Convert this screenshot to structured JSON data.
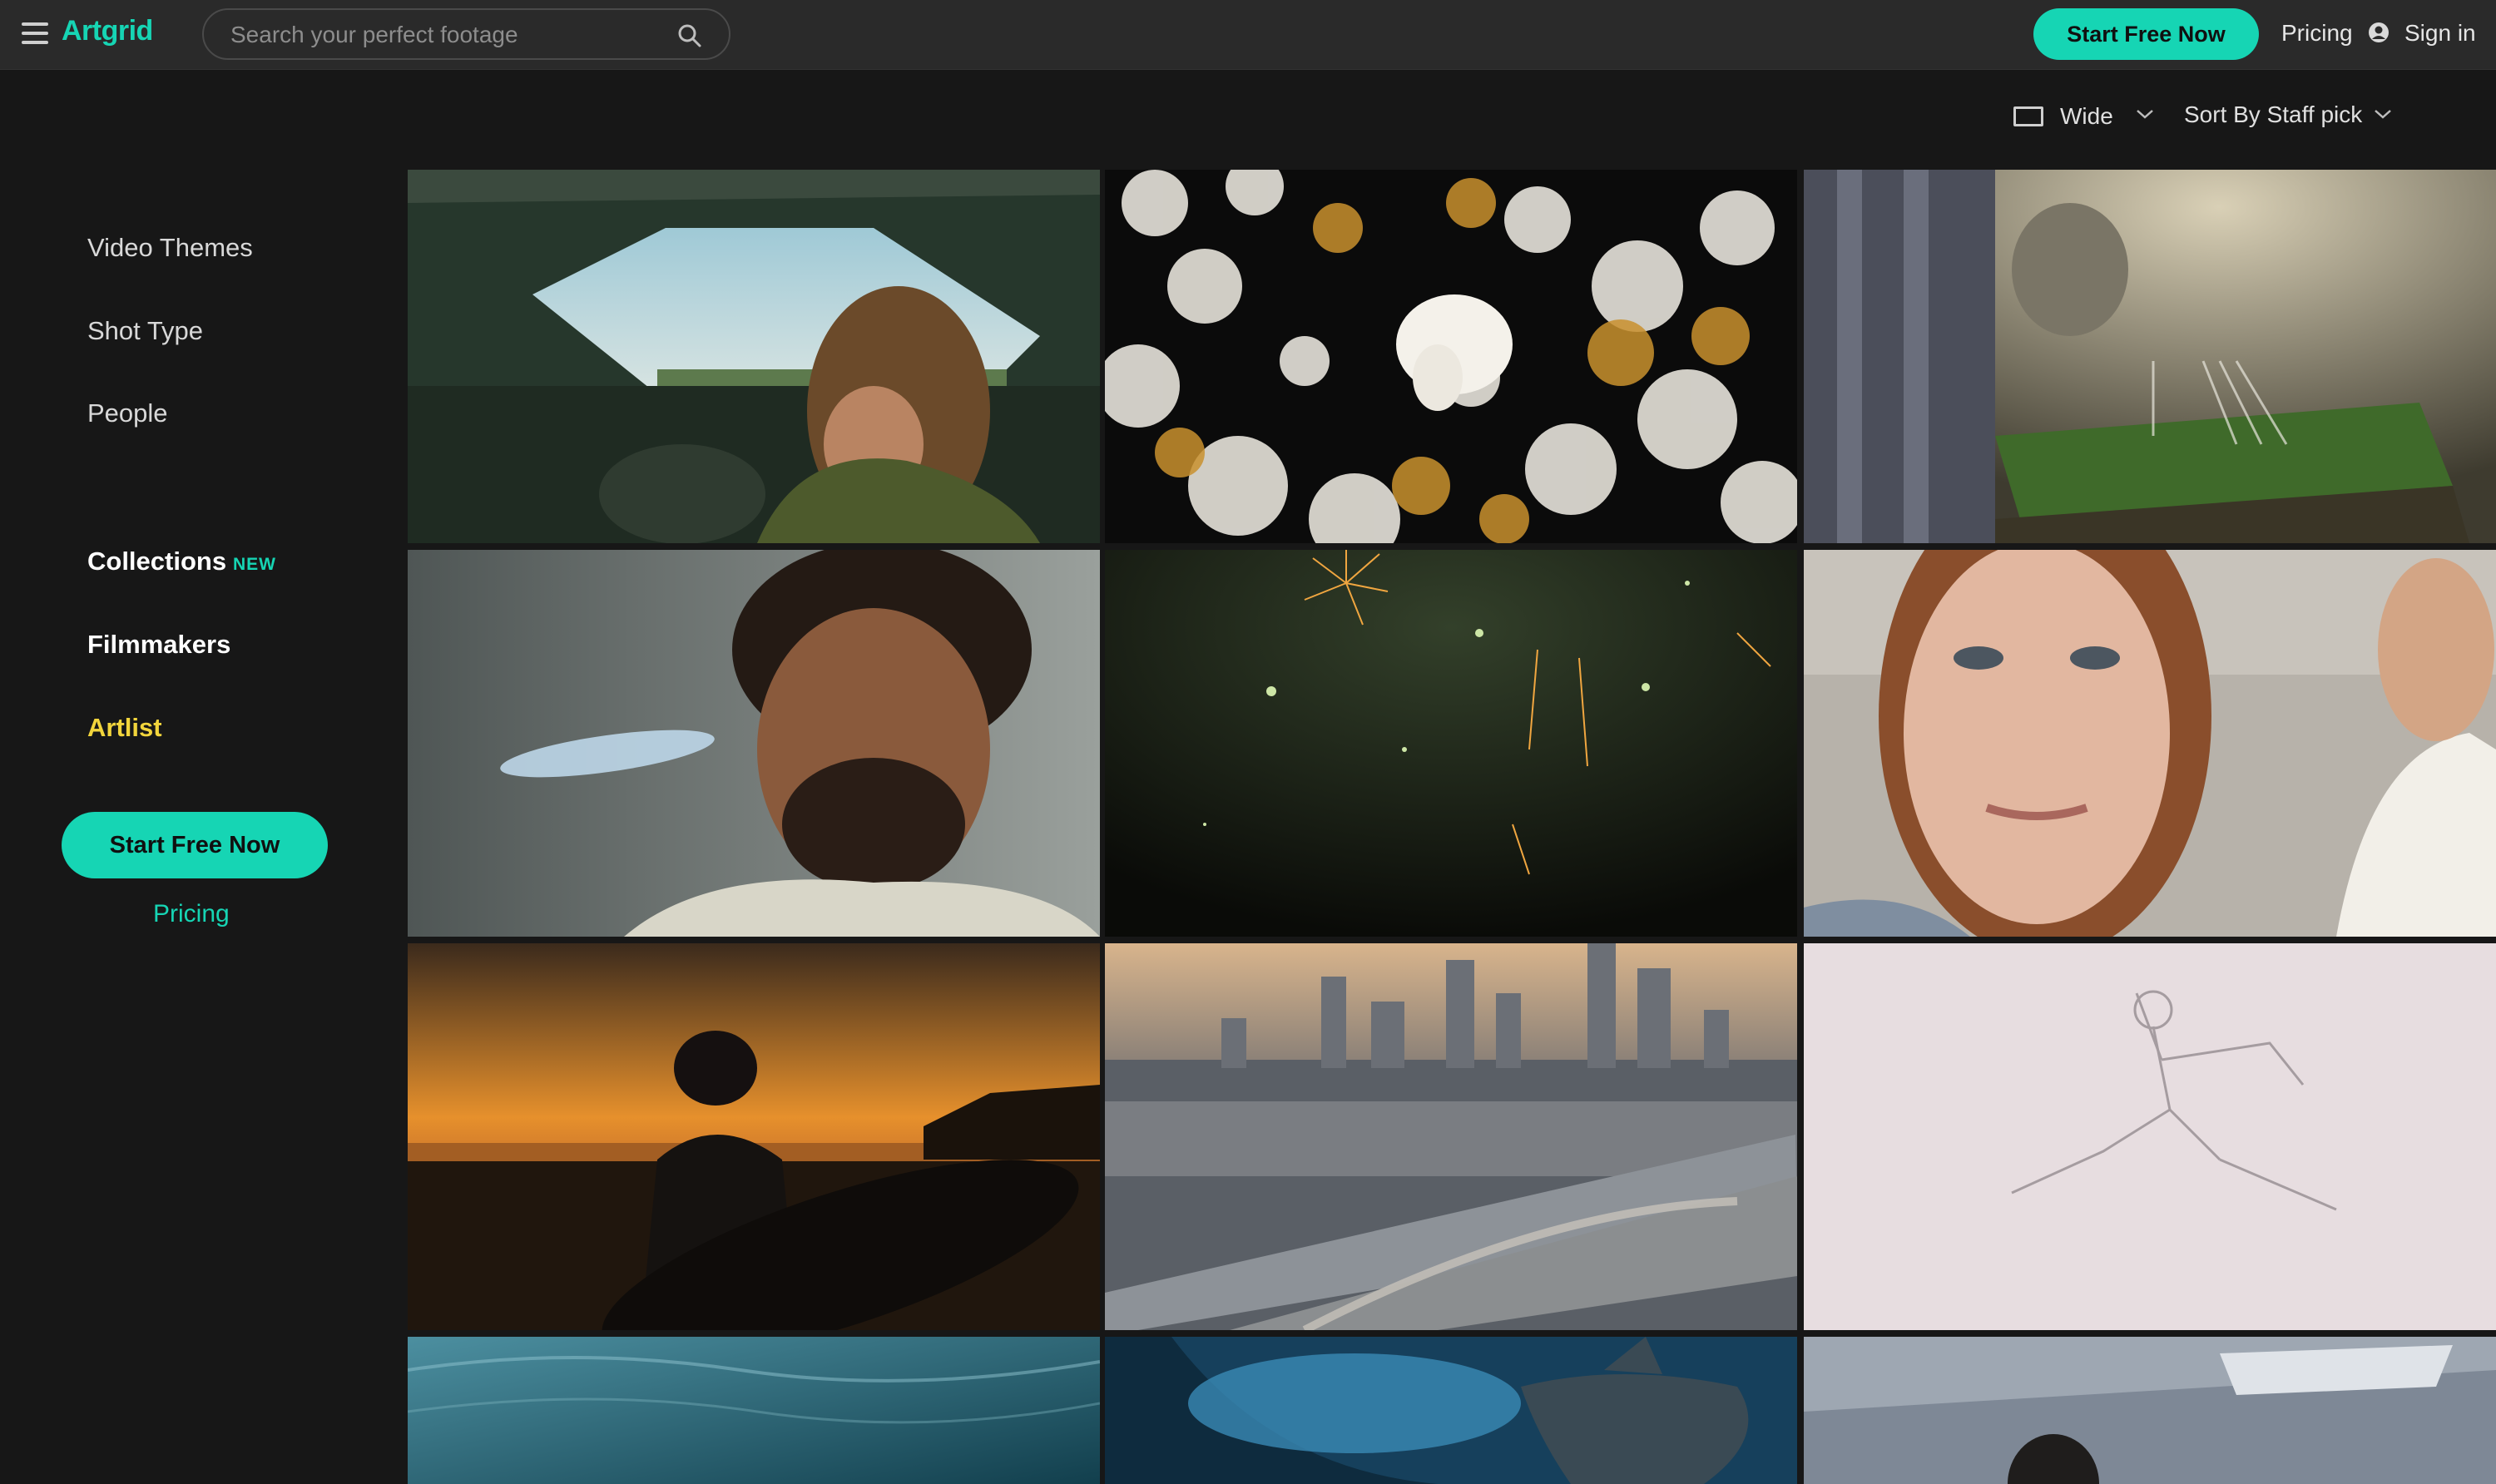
{
  "header": {
    "logo": "Artgrid",
    "search_placeholder": "Search your perfect footage",
    "cta_label": "Start Free Now",
    "pricing_label": "Pricing",
    "signin_label": "Sign in"
  },
  "toolbar": {
    "aspect_label": "Wide",
    "sort_label": "Sort By Staff pick"
  },
  "sidebar": {
    "categories": [
      "Video Themes",
      "Shot Type",
      "People"
    ],
    "collections_label": "Collections",
    "new_badge": "NEW",
    "filmmakers_label": "Filmmakers",
    "artist_label": "Artlist",
    "cta_label": "Start Free Now",
    "pricing_label": "Pricing"
  },
  "icons": {
    "menu": "hamburger-icon",
    "search": "search-icon",
    "user": "user-circle-icon",
    "aspect": "aspect-ratio-icon",
    "dropdown": "chevron-down-icon"
  },
  "colors": {
    "accent": "#16d5b4",
    "artist": "#f2d53c",
    "topbar": "#2a2a2a",
    "background": "#171717"
  }
}
